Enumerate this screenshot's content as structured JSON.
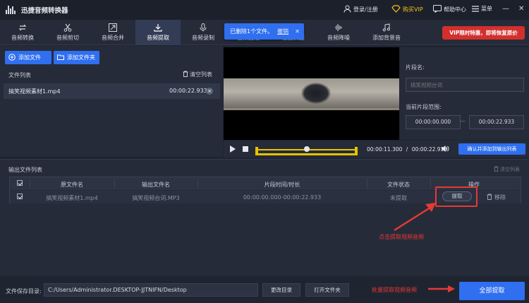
{
  "app": {
    "title": "迅捷音频转换器"
  },
  "titlebar": {
    "login": "登录/注册",
    "vip": "购买VIP",
    "help": "帮助中心",
    "menu": "菜单",
    "minimize": "—",
    "close": "✕"
  },
  "toolbar": {
    "tabs": [
      {
        "label": "音频转换",
        "icon": "convert-icon"
      },
      {
        "label": "音频剪切",
        "icon": "scissors-icon"
      },
      {
        "label": "音频合并",
        "icon": "merge-icon"
      },
      {
        "label": "音频提取",
        "icon": "extract-icon",
        "active": true
      },
      {
        "label": "音频录制",
        "icon": "mic-icon"
      },
      {
        "label": "音频变速",
        "icon": "speed-icon"
      },
      {
        "label": "音量调整",
        "icon": "volume-icon"
      },
      {
        "label": "音频降噪",
        "icon": "denoise-icon"
      },
      {
        "label": "添加背景音",
        "icon": "music-add-icon"
      }
    ],
    "vip_banner": "VIP限时特惠，即将恢复原价"
  },
  "toast": {
    "message": "已删除1个文件。",
    "undo": "撤销",
    "close": "✕"
  },
  "file_panel": {
    "add_file": "添加文件",
    "add_folder": "添加文件夹",
    "list_title": "文件列表",
    "clear_list": "清空列表",
    "file": {
      "name": "搞笑视频素材1.mp4",
      "duration": "00:00:22.933",
      "remove": "×"
    }
  },
  "segment": {
    "name_label": "片段名:",
    "name_placeholder": "搞笑视频台词",
    "range_label": "当前片段范围:",
    "start": "00:00:00.000",
    "separator": "—",
    "end": "00:00:22.933"
  },
  "player": {
    "current": "00:00:11.300",
    "separator": "/",
    "total": "00:00:22.933",
    "progress": 0.49,
    "add_to_output": "确认并添加到输出列表"
  },
  "output": {
    "title": "输出文件列表",
    "clear": "清空列表",
    "columns": [
      "原文件名",
      "输出文件名",
      "片段时间/时长",
      "文件状态",
      "操作"
    ],
    "rows": [
      {
        "source": "搞笑视频素材1.mp4",
        "output": "搞笑视频台词.MP3",
        "time": "00:00:00.000-00:00:22.933",
        "status": "未提取",
        "extract": "提取",
        "remove": "移除"
      }
    ],
    "annotation": "点击提取视频音频"
  },
  "bottom": {
    "save_label": "文件保存目录:",
    "save_path": "C:/Users/Administrator.DESKTOP-JJTNIFN/Desktop",
    "change_dir": "更改目录",
    "open_folder": "打开文件夹",
    "annotation": "批量提取视频音频",
    "extract_all": "全部提取"
  },
  "colors": {
    "accent": "#2f6ff0",
    "annotation": "#e53935",
    "vip": "#f3c21d",
    "vip_banner": "#d32f2f",
    "timeline": "#e5c300"
  }
}
